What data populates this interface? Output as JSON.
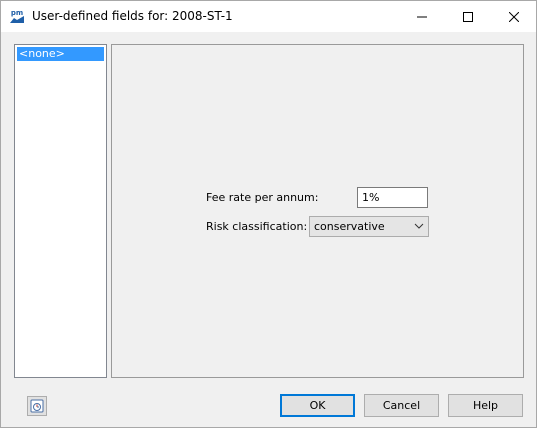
{
  "window": {
    "title": "User-defined fields for: 2008-ST-1",
    "app_icon_text": "pm"
  },
  "list": {
    "items": [
      {
        "label": "<none>",
        "selected": true
      }
    ]
  },
  "form": {
    "fee_label": "Fee rate per annum:",
    "fee_value": "1%",
    "risk_label": "Risk classification:",
    "risk_value": "conservative"
  },
  "buttons": {
    "ok": "OK",
    "cancel": "Cancel",
    "help": "Help"
  },
  "icons": {
    "app": "pm-app-icon",
    "minimize": "minimize-icon",
    "maximize": "maximize-icon",
    "close": "close-icon",
    "dropdown": "chevron-down-icon",
    "bottom_left": "calculator-icon"
  },
  "colors": {
    "selection": "#3399ff",
    "default_button_border": "#0078d7"
  }
}
